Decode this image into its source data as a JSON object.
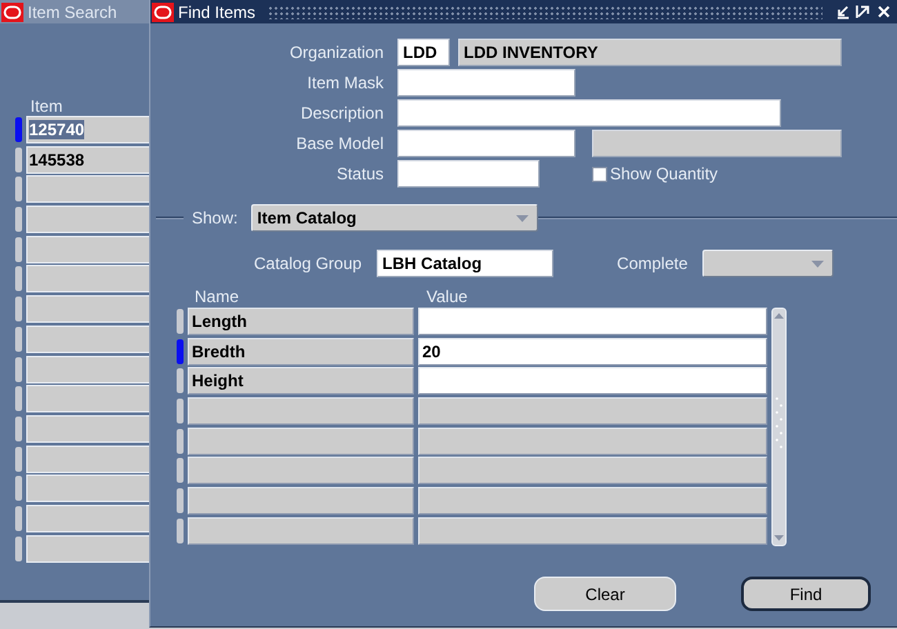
{
  "background_window": {
    "title": "Item Search",
    "active": false,
    "column": "Item",
    "rows": [
      {
        "value": "125740",
        "current": true,
        "selected": true
      },
      {
        "value": "145538",
        "current": false,
        "selected": false
      },
      {
        "current": false
      },
      {
        "current": false
      },
      {
        "current": false
      },
      {
        "current": false
      },
      {
        "current": false
      },
      {
        "current": false
      },
      {
        "current": false
      },
      {
        "current": false
      },
      {
        "current": false
      },
      {
        "current": false
      },
      {
        "current": false
      },
      {
        "current": false
      },
      {
        "current": false
      }
    ]
  },
  "find_window": {
    "title": "Find Items",
    "active": true,
    "fields": [
      {
        "label": "Organization",
        "controls": [
          {
            "kind": "field",
            "value": "LDD",
            "disabled": false
          },
          {
            "kind": "field",
            "value": "LDD INVENTORY",
            "disabled": true
          }
        ]
      },
      {
        "label": "Item Mask",
        "controls": [
          {
            "kind": "field",
            "disabled": false
          }
        ]
      },
      {
        "label": "Description",
        "controls": [
          {
            "kind": "field",
            "disabled": false
          }
        ]
      },
      {
        "label": "Base Model",
        "controls": [
          {
            "kind": "field",
            "disabled": false
          },
          {
            "kind": "field",
            "disabled": true
          }
        ]
      },
      {
        "label": "Status",
        "controls": [
          {
            "kind": "field",
            "disabled": false
          },
          {
            "kind": "checkbox",
            "label": "Show Quantity",
            "checked": false
          }
        ]
      }
    ],
    "show": {
      "label": "Show:",
      "value": "Item Catalog"
    },
    "catalog_group": {
      "label": "Catalog Group",
      "value": "LBH Catalog"
    },
    "complete": {
      "label": "Complete",
      "disabled": true
    },
    "table": {
      "columns": [
        "Name",
        "Value"
      ],
      "rows": [
        {
          "name": "Length",
          "editable": true,
          "current": false
        },
        {
          "name": "Bredth",
          "value": "20",
          "editable": true,
          "current": true
        },
        {
          "name": "Height",
          "editable": true,
          "current": false
        },
        {
          "editable": false,
          "current": false
        },
        {
          "editable": false,
          "current": false
        },
        {
          "editable": false,
          "current": false
        },
        {
          "editable": false,
          "current": false
        },
        {
          "editable": false,
          "current": false
        }
      ]
    },
    "buttons": [
      {
        "label": "Clear",
        "default": false
      },
      {
        "label": "Find",
        "default": true
      }
    ]
  }
}
